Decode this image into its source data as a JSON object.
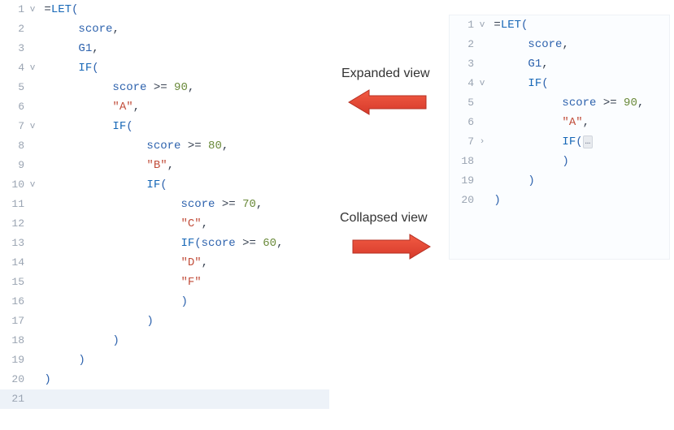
{
  "labels": {
    "expanded": "Expanded view",
    "collapsed": "Collapsed view"
  },
  "left": {
    "lines": [
      {
        "n": "1",
        "fold": "v",
        "indent": 0,
        "tokens": [
          {
            "t": "=",
            "c": "op"
          },
          {
            "t": "LET",
            "c": "kw-let"
          },
          {
            "t": "(",
            "c": "paren"
          }
        ]
      },
      {
        "n": "2",
        "fold": "",
        "indent": 1,
        "tokens": [
          {
            "t": "score",
            "c": "ident"
          },
          {
            "t": ",",
            "c": "op"
          }
        ]
      },
      {
        "n": "3",
        "fold": "",
        "indent": 1,
        "tokens": [
          {
            "t": "G1",
            "c": "ident"
          },
          {
            "t": ",",
            "c": "op"
          }
        ]
      },
      {
        "n": "4",
        "fold": "v",
        "indent": 1,
        "tokens": [
          {
            "t": "IF",
            "c": "kw-func"
          },
          {
            "t": "(",
            "c": "paren"
          }
        ]
      },
      {
        "n": "5",
        "fold": "",
        "indent": 2,
        "tokens": [
          {
            "t": "score",
            "c": "ident"
          },
          {
            "t": " >= ",
            "c": "op"
          },
          {
            "t": "90",
            "c": "num"
          },
          {
            "t": ",",
            "c": "op"
          }
        ]
      },
      {
        "n": "6",
        "fold": "",
        "indent": 2,
        "tokens": [
          {
            "t": "\"A\"",
            "c": "str"
          },
          {
            "t": ",",
            "c": "op"
          }
        ]
      },
      {
        "n": "7",
        "fold": "v",
        "indent": 2,
        "tokens": [
          {
            "t": "IF",
            "c": "kw-func"
          },
          {
            "t": "(",
            "c": "paren"
          }
        ]
      },
      {
        "n": "8",
        "fold": "",
        "indent": 3,
        "tokens": [
          {
            "t": "score",
            "c": "ident"
          },
          {
            "t": " >= ",
            "c": "op"
          },
          {
            "t": "80",
            "c": "num"
          },
          {
            "t": ",",
            "c": "op"
          }
        ]
      },
      {
        "n": "9",
        "fold": "",
        "indent": 3,
        "tokens": [
          {
            "t": "\"B\"",
            "c": "str"
          },
          {
            "t": ",",
            "c": "op"
          }
        ]
      },
      {
        "n": "10",
        "fold": "v",
        "indent": 3,
        "tokens": [
          {
            "t": "IF",
            "c": "kw-func"
          },
          {
            "t": "(",
            "c": "paren"
          }
        ]
      },
      {
        "n": "11",
        "fold": "",
        "indent": 4,
        "tokens": [
          {
            "t": "score",
            "c": "ident"
          },
          {
            "t": " >= ",
            "c": "op"
          },
          {
            "t": "70",
            "c": "num"
          },
          {
            "t": ",",
            "c": "op"
          }
        ]
      },
      {
        "n": "12",
        "fold": "",
        "indent": 4,
        "tokens": [
          {
            "t": "\"C\"",
            "c": "str"
          },
          {
            "t": ",",
            "c": "op"
          }
        ]
      },
      {
        "n": "13",
        "fold": "",
        "indent": 4,
        "tokens": [
          {
            "t": "IF",
            "c": "kw-func"
          },
          {
            "t": "(",
            "c": "paren"
          },
          {
            "t": "score",
            "c": "ident"
          },
          {
            "t": " >= ",
            "c": "op"
          },
          {
            "t": "60",
            "c": "num"
          },
          {
            "t": ",",
            "c": "op"
          }
        ]
      },
      {
        "n": "14",
        "fold": "",
        "indent": 4,
        "tokens": [
          {
            "t": "\"D\"",
            "c": "str"
          },
          {
            "t": ",",
            "c": "op"
          }
        ]
      },
      {
        "n": "15",
        "fold": "",
        "indent": 4,
        "tokens": [
          {
            "t": "\"F\"",
            "c": "str"
          }
        ]
      },
      {
        "n": "16",
        "fold": "",
        "indent": 4,
        "tokens": [
          {
            "t": ")",
            "c": "paren"
          }
        ]
      },
      {
        "n": "17",
        "fold": "",
        "indent": 3,
        "tokens": [
          {
            "t": ")",
            "c": "paren"
          }
        ]
      },
      {
        "n": "18",
        "fold": "",
        "indent": 2,
        "tokens": [
          {
            "t": ")",
            "c": "paren"
          }
        ]
      },
      {
        "n": "19",
        "fold": "",
        "indent": 1,
        "tokens": [
          {
            "t": ")",
            "c": "paren"
          }
        ]
      },
      {
        "n": "20",
        "fold": "",
        "indent": 0,
        "tokens": [
          {
            "t": ")",
            "c": "paren"
          }
        ]
      },
      {
        "n": "21",
        "fold": "",
        "indent": 0,
        "tokens": [],
        "hl": true
      }
    ]
  },
  "right": {
    "lines": [
      {
        "n": "1",
        "fold": "v",
        "indent": 0,
        "tokens": [
          {
            "t": "=",
            "c": "op"
          },
          {
            "t": "LET",
            "c": "kw-let"
          },
          {
            "t": "(",
            "c": "paren"
          }
        ]
      },
      {
        "n": "2",
        "fold": "",
        "indent": 1,
        "tokens": [
          {
            "t": "score",
            "c": "ident"
          },
          {
            "t": ",",
            "c": "op"
          }
        ]
      },
      {
        "n": "3",
        "fold": "",
        "indent": 1,
        "tokens": [
          {
            "t": "G1",
            "c": "ident"
          },
          {
            "t": ",",
            "c": "op"
          }
        ]
      },
      {
        "n": "4",
        "fold": "v",
        "indent": 1,
        "tokens": [
          {
            "t": "IF",
            "c": "kw-func"
          },
          {
            "t": "(",
            "c": "paren"
          }
        ]
      },
      {
        "n": "5",
        "fold": "",
        "indent": 2,
        "tokens": [
          {
            "t": "score",
            "c": "ident"
          },
          {
            "t": " >= ",
            "c": "op"
          },
          {
            "t": "90",
            "c": "num"
          },
          {
            "t": ",",
            "c": "op"
          }
        ]
      },
      {
        "n": "6",
        "fold": "",
        "indent": 2,
        "tokens": [
          {
            "t": "\"A\"",
            "c": "str"
          },
          {
            "t": ",",
            "c": "op"
          }
        ]
      },
      {
        "n": "7",
        "fold": "›",
        "indent": 2,
        "tokens": [
          {
            "t": "IF",
            "c": "kw-func"
          },
          {
            "t": "(",
            "c": "paren"
          },
          {
            "t": "…",
            "c": "ellipsis"
          }
        ]
      },
      {
        "n": "18",
        "fold": "",
        "indent": 2,
        "tokens": [
          {
            "t": ")",
            "c": "paren"
          }
        ]
      },
      {
        "n": "19",
        "fold": "",
        "indent": 1,
        "tokens": [
          {
            "t": ")",
            "c": "paren"
          }
        ]
      },
      {
        "n": "20",
        "fold": "",
        "indent": 0,
        "tokens": [
          {
            "t": ")",
            "c": "paren"
          }
        ]
      }
    ]
  }
}
